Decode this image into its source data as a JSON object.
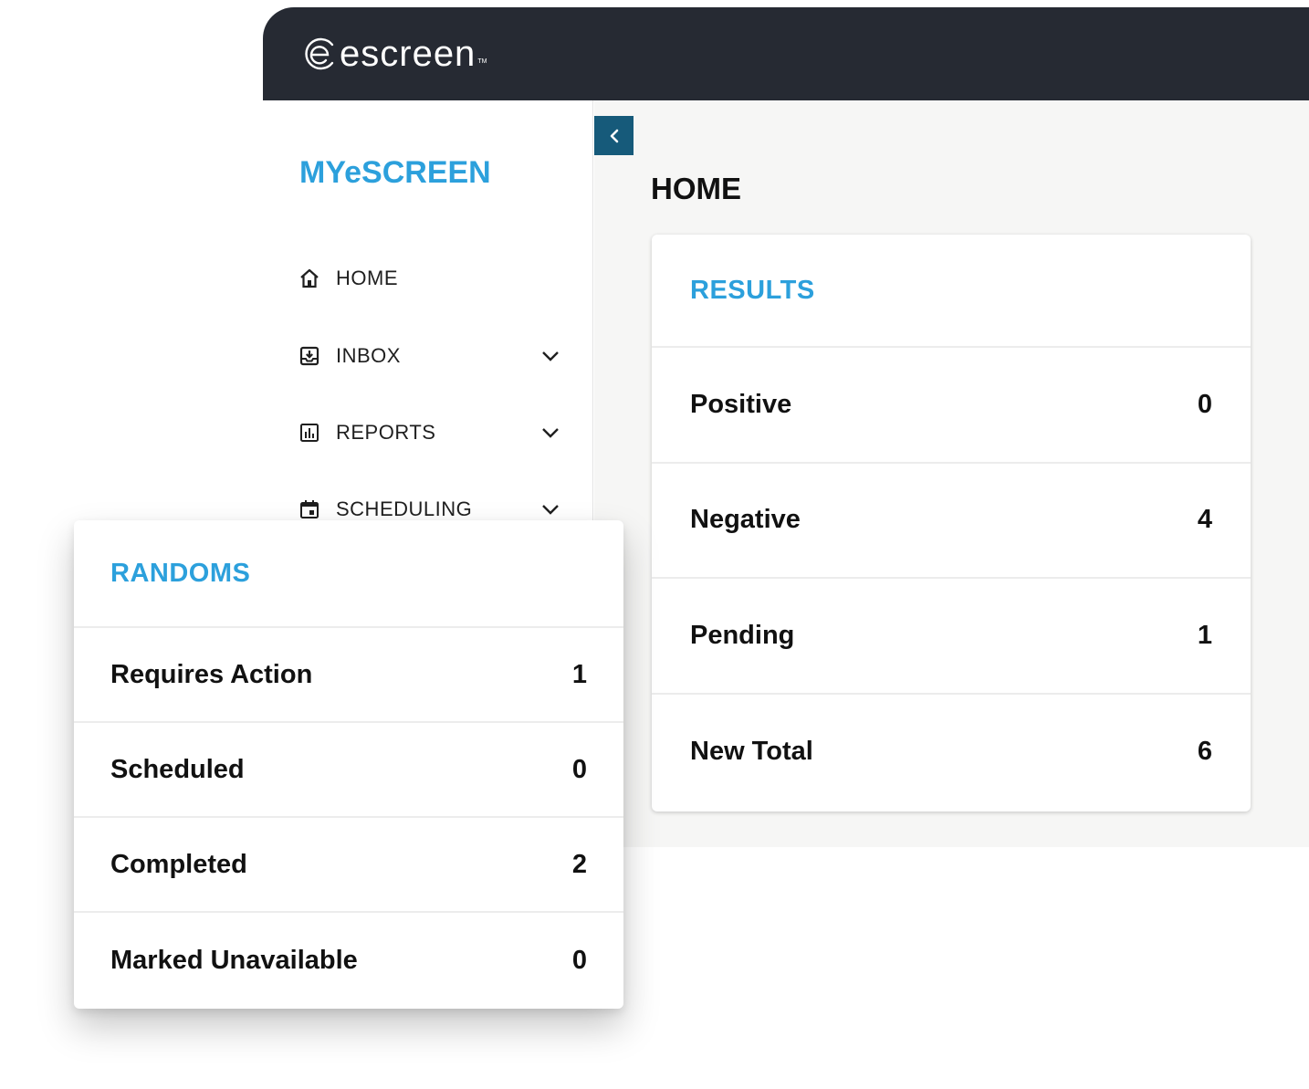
{
  "header": {
    "logo_text": "escreen",
    "logo_tm": "TM"
  },
  "sidebar": {
    "brand": "MYeSCREEN",
    "items": [
      {
        "label": "HOME",
        "icon": "home-icon",
        "has_chevron": false
      },
      {
        "label": "INBOX",
        "icon": "inbox-icon",
        "has_chevron": true
      },
      {
        "label": "REPORTS",
        "icon": "bar-chart-icon",
        "has_chevron": true
      },
      {
        "label": "SCHEDULING",
        "icon": "calendar-icon",
        "has_chevron": true
      }
    ]
  },
  "main": {
    "collapse_icon": "chevron-left-icon",
    "page_title": "HOME"
  },
  "results_card": {
    "title": "RESULTS",
    "rows": [
      {
        "label": "Positive",
        "value": "0"
      },
      {
        "label": "Negative",
        "value": "4"
      },
      {
        "label": "Pending",
        "value": "1"
      },
      {
        "label": "New Total",
        "value": "6"
      }
    ]
  },
  "randoms_card": {
    "title": "RANDOMS",
    "rows": [
      {
        "label": "Requires Action",
        "value": "1"
      },
      {
        "label": "Scheduled",
        "value": "0"
      },
      {
        "label": "Completed",
        "value": "2"
      },
      {
        "label": "Marked Unavailable",
        "value": "0"
      }
    ]
  },
  "colors": {
    "header_bg": "#262a33",
    "accent_blue": "#2ca0dc",
    "collapse_btn": "#165a7a",
    "main_bg": "#f6f6f5"
  }
}
